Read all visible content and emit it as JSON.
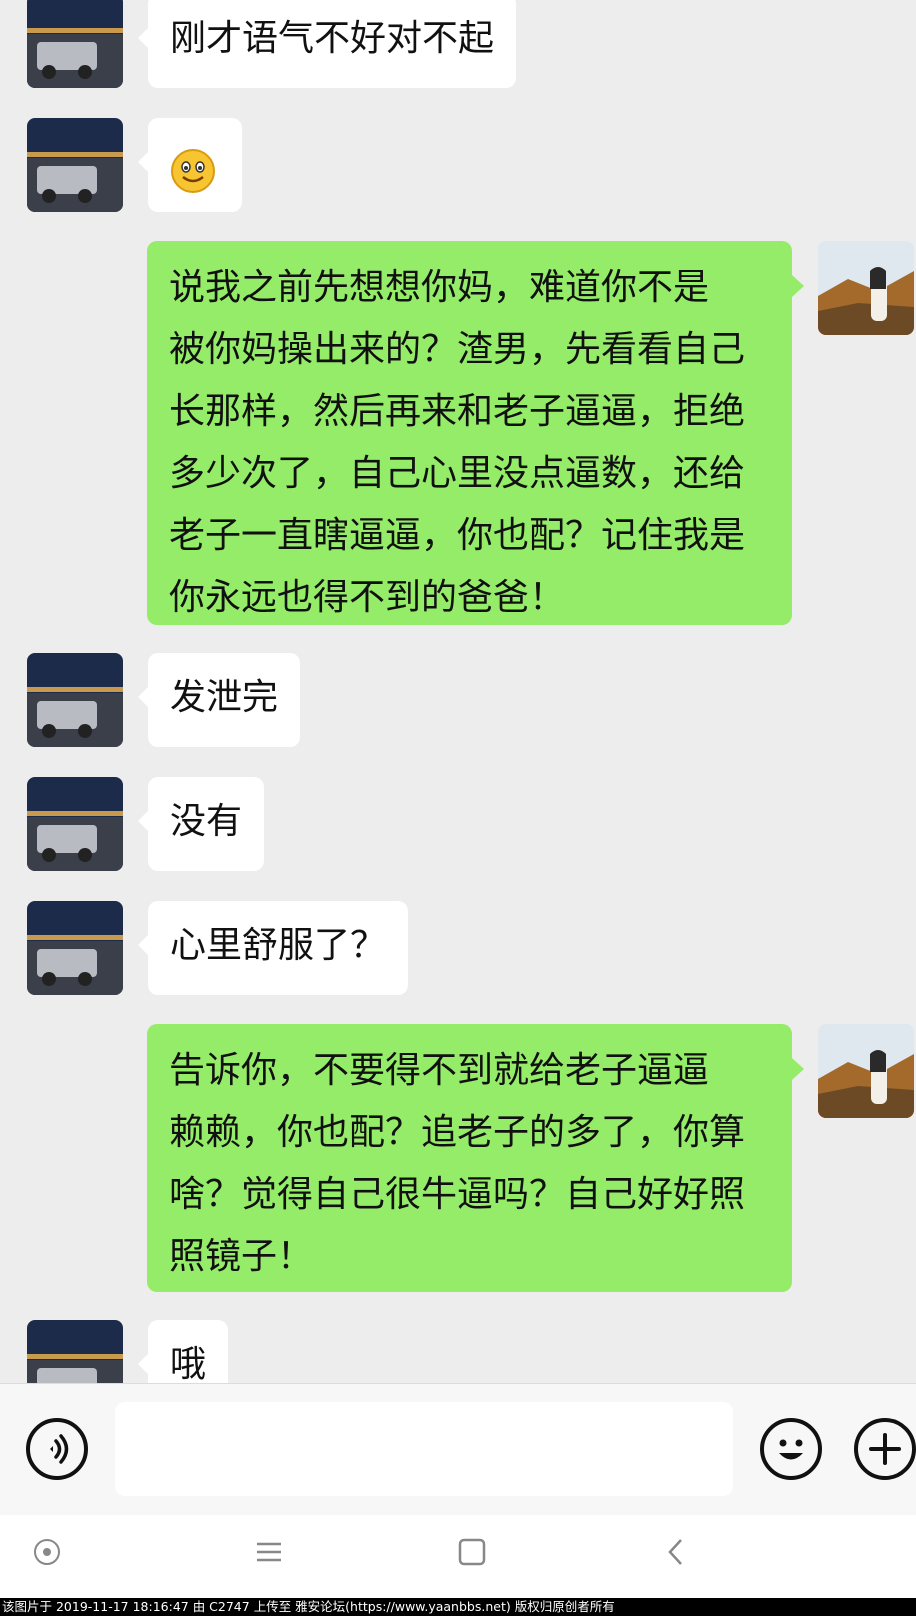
{
  "messages": [
    {
      "side": "in",
      "lines": [
        "刚才语气不好对不起"
      ]
    },
    {
      "side": "in",
      "emoji": "smile-emoji"
    },
    {
      "side": "out",
      "lines": [
        "说我之前先想想你妈，难道你不是",
        "被你妈操出来的？渣男，先看看自己",
        "长那样，然后再来和老子逼逼，拒绝",
        "多少次了，自己心里没点逼数，还给",
        "老子一直瞎逼逼，你也配？记住我是",
        "你永远也得不到的爸爸！"
      ]
    },
    {
      "side": "in",
      "lines": [
        "发泄完"
      ]
    },
    {
      "side": "in",
      "lines": [
        "没有"
      ]
    },
    {
      "side": "in",
      "lines": [
        "心里舒服了？"
      ]
    },
    {
      "side": "out",
      "lines": [
        "告诉你，不要得不到就给老子逼逼",
        "赖赖，你也配？追老子的多了，你算",
        "啥？觉得自己很牛逼吗？自己好好照",
        "照镜子！"
      ]
    },
    {
      "side": "in",
      "lines": [
        "哦"
      ]
    }
  ],
  "input": {
    "voice_icon": "voice-icon",
    "emoji_icon": "emoji-icon",
    "plus_icon": "plus-icon"
  },
  "navbar": {
    "home_icon": "home-circle-icon",
    "menu_icon": "menu-lines-icon",
    "recents_icon": "square-icon",
    "back_icon": "back-chevron-icon"
  },
  "footer": {
    "caption": "该图片于 2019-11-17 18:16:47 由 C2747 上传至 雅安论坛(https://www.yaanbbs.net) 版权归原创者所有"
  },
  "colors": {
    "background": "#ededed",
    "outgoing_bubble": "#95ec69",
    "incoming_bubble": "#ffffff"
  }
}
